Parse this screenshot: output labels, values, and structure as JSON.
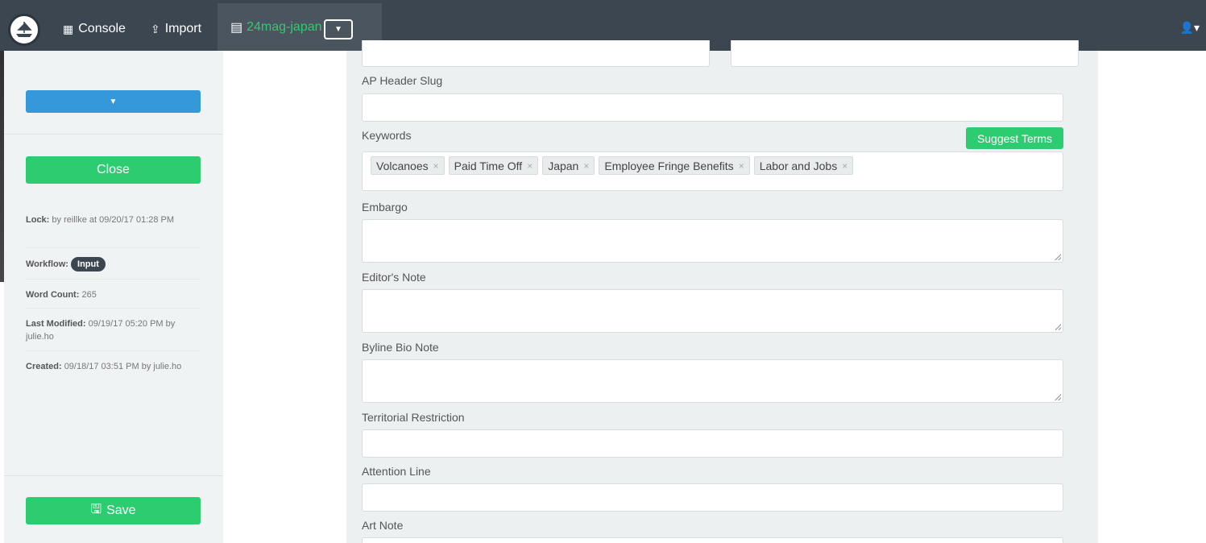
{
  "navbar": {
    "console_label": "Console",
    "import_label": "Import",
    "document_label": "24mag-japan",
    "icons": {
      "logo": "ship-logo-icon",
      "console": "table-icon",
      "import": "upload-icon",
      "document": "file-icon",
      "dropdown": "caret-down-icon",
      "user": "user-icon"
    }
  },
  "sidebar": {
    "close_label": "Close",
    "lock_label": "Lock:",
    "lock_value": "by reillke at 09/20/17 01:28 PM",
    "workflow_label": "Workflow:",
    "workflow_value": "Input",
    "word_count_label": "Word Count:",
    "word_count_value": "265",
    "last_modified_label": "Last Modified:",
    "last_modified_value": "09/19/17 05:20 PM by julie.ho",
    "created_label": "Created:",
    "created_value": "09/18/17 03:51 PM by julie.ho",
    "save_label": "Save"
  },
  "form": {
    "ap_header_slug_label": "AP Header Slug",
    "keywords_label": "Keywords",
    "suggest_terms_label": "Suggest Terms",
    "keywords": [
      "Volcanoes",
      "Paid Time Off",
      "Japan",
      "Employee Fringe Benefits",
      "Labor and Jobs"
    ],
    "embargo_label": "Embargo",
    "editors_note_label": "Editor's Note",
    "byline_bio_note_label": "Byline Bio Note",
    "territorial_restriction_label": "Territorial Restriction",
    "attention_line_label": "Attention Line",
    "art_note_label": "Art Note"
  },
  "colors": {
    "navbar": "#3b4650",
    "accent_green": "#2ecc71",
    "accent_blue": "#3498db"
  }
}
